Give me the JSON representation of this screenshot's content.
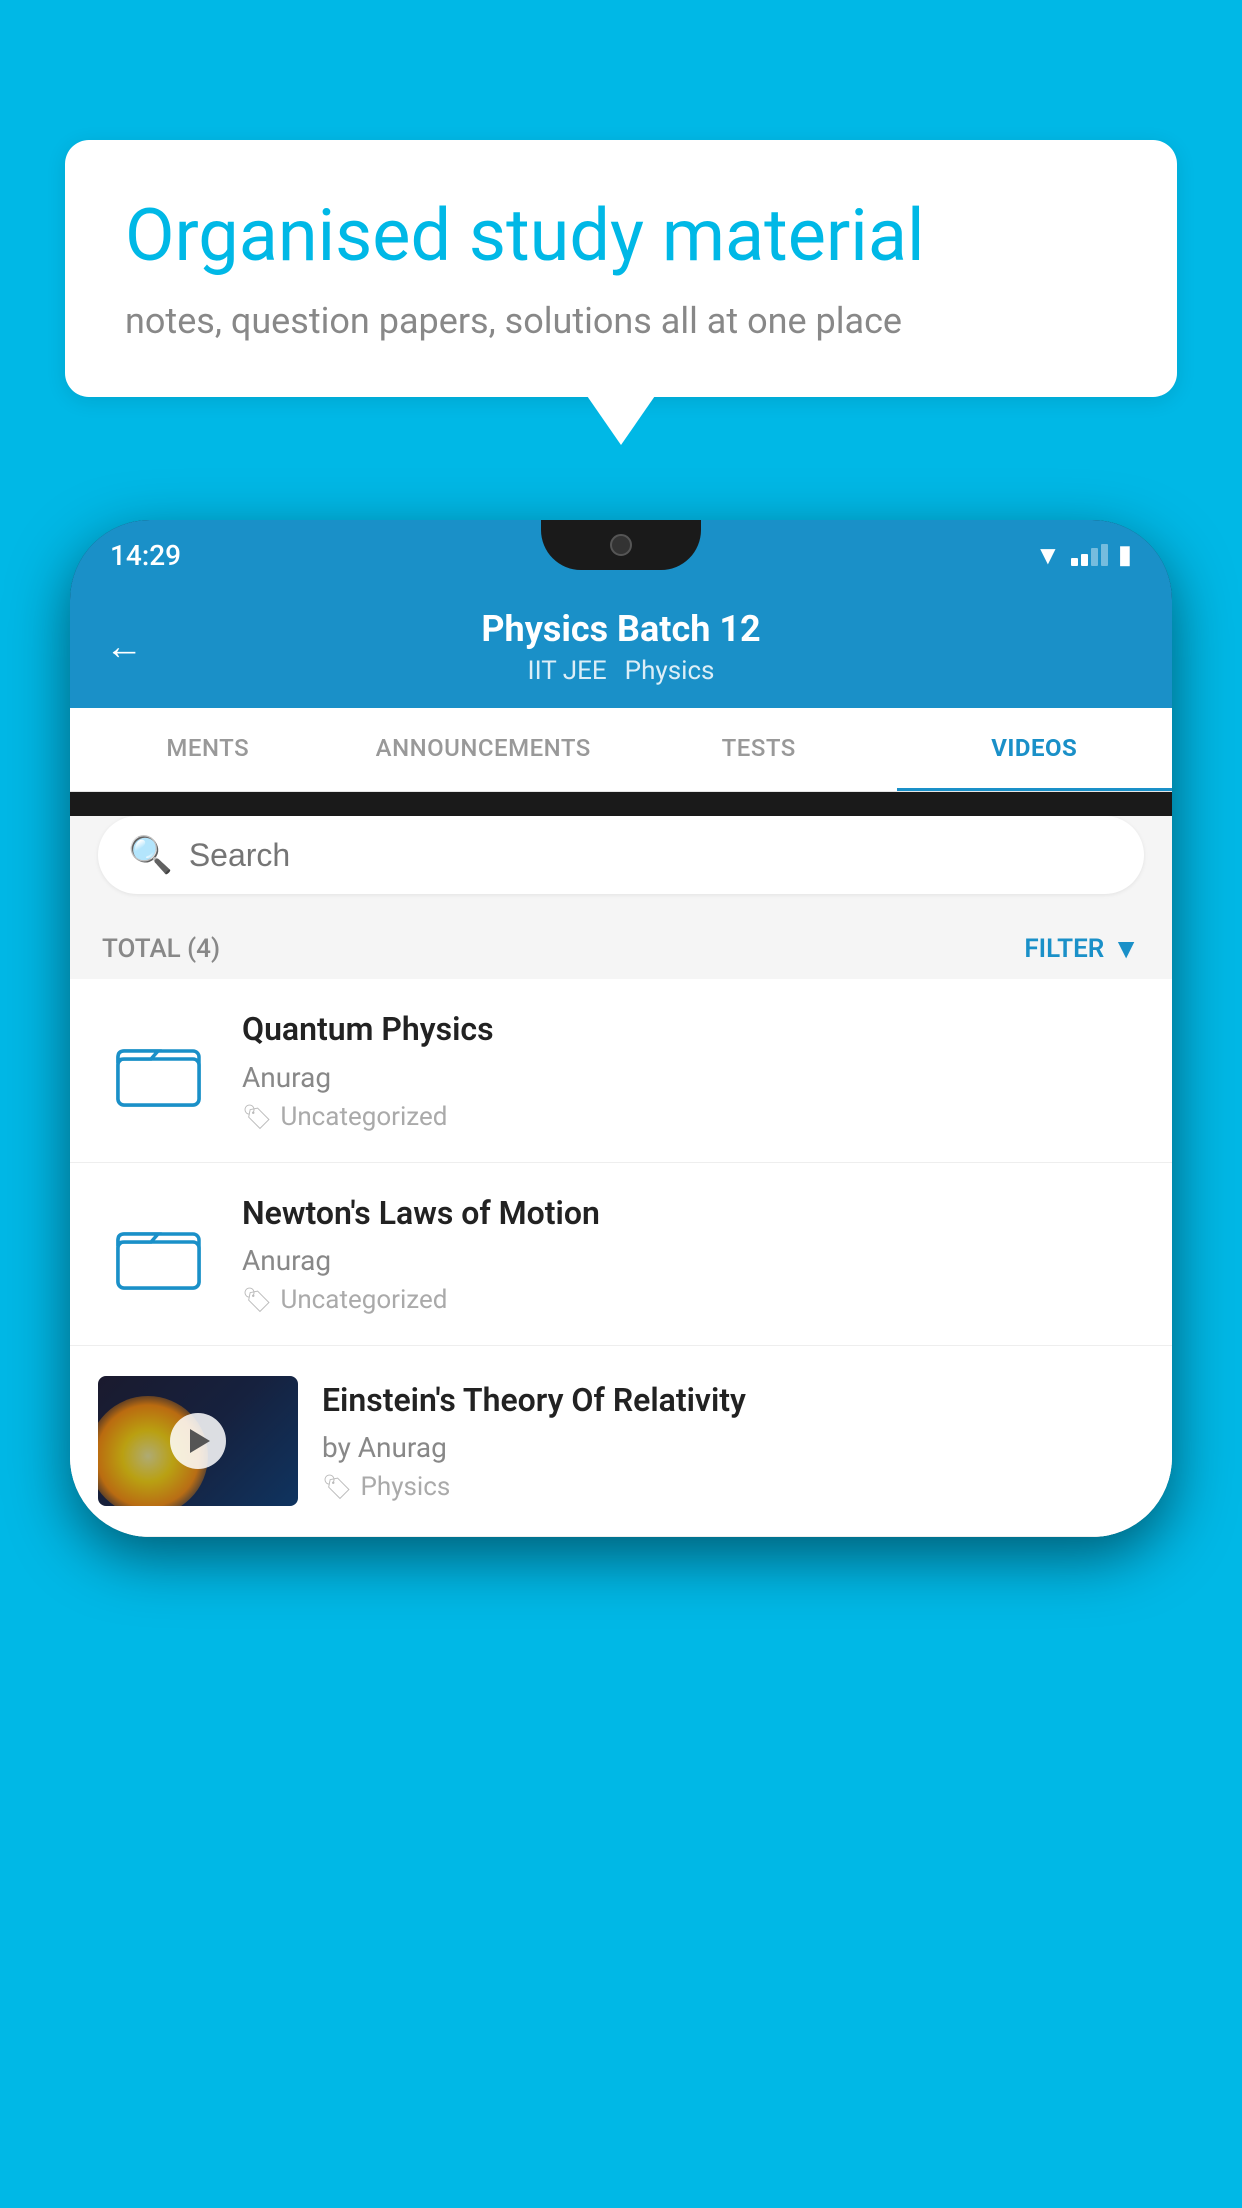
{
  "page": {
    "bg_color": "#00b8e6"
  },
  "speech_bubble": {
    "headline": "Organised study material",
    "subtext": "notes, question papers, solutions all at one place"
  },
  "phone": {
    "status_bar": {
      "time": "14:29"
    },
    "header": {
      "back_label": "←",
      "title": "Physics Batch 12",
      "subtitle1": "IIT JEE",
      "subtitle2": "Physics"
    },
    "tabs": [
      {
        "label": "MENTS",
        "active": false
      },
      {
        "label": "ANNOUNCEMENTS",
        "active": false
      },
      {
        "label": "TESTS",
        "active": false
      },
      {
        "label": "VIDEOS",
        "active": true
      }
    ],
    "search": {
      "placeholder": "Search"
    },
    "filter": {
      "total_label": "TOTAL (4)",
      "filter_label": "FILTER"
    },
    "videos": [
      {
        "title": "Quantum Physics",
        "author": "Anurag",
        "tag": "Uncategorized",
        "type": "folder",
        "has_thumb": false
      },
      {
        "title": "Newton's Laws of Motion",
        "author": "Anurag",
        "tag": "Uncategorized",
        "type": "folder",
        "has_thumb": false
      },
      {
        "title": "Einstein's Theory Of Relativity",
        "author": "by Anurag",
        "tag": "Physics",
        "type": "video",
        "has_thumb": true
      }
    ]
  }
}
